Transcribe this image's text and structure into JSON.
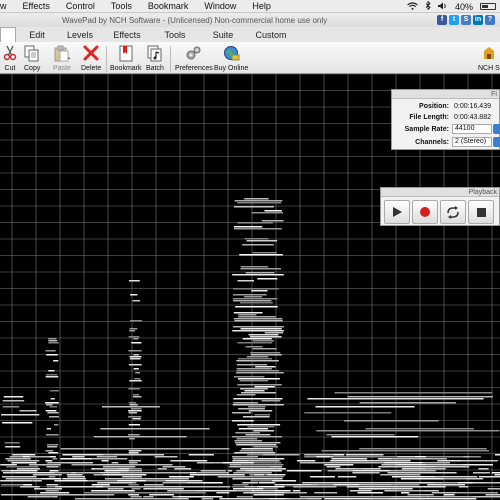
{
  "menubar": {
    "items": [
      "w",
      "Effects",
      "Control",
      "Tools",
      "Bookmark",
      "Window",
      "Help"
    ],
    "battery_percent": "40%"
  },
  "window": {
    "title": "WavePad by NCH Software - (Unlicensed) Non-commercial home use only"
  },
  "social": [
    {
      "icon": "facebook-icon",
      "glyph": "f",
      "color": "#3b5998"
    },
    {
      "icon": "twitter-icon",
      "glyph": "t",
      "color": "#1da1f2"
    },
    {
      "icon": "social-icon",
      "glyph": "S",
      "color": "#4a7bc8"
    },
    {
      "icon": "linkedin-icon",
      "glyph": "in",
      "color": "#0077b5"
    },
    {
      "icon": "help-icon",
      "glyph": "?",
      "color": "#3c78c8"
    }
  ],
  "tabs": [
    "",
    "Edit",
    "Levels",
    "Effects",
    "Tools",
    "Suite",
    "Custom"
  ],
  "toolbar": {
    "cut": "Cut",
    "copy": "Copy",
    "paste": "Paste",
    "delete": "Delete",
    "bookmark": "Bookmark",
    "batch": "Batch",
    "preferences": "Preferences",
    "buy_online": "Buy Online",
    "brand": "NCH S"
  },
  "file_info": {
    "header": "Fi",
    "position_label": "Position:",
    "position_value": "0:00:16.439",
    "length_label": "File Length:",
    "length_value": "0:00:43.882",
    "rate_label": "Sample Rate:",
    "rate_value": "44100",
    "channels_label": "Channels:",
    "channels_value": "2 (Stereo)"
  },
  "playback": {
    "header": "Playback"
  },
  "colors": {
    "accent": "#3b7fd4",
    "record": "#d32020",
    "delete": "#e02424"
  }
}
